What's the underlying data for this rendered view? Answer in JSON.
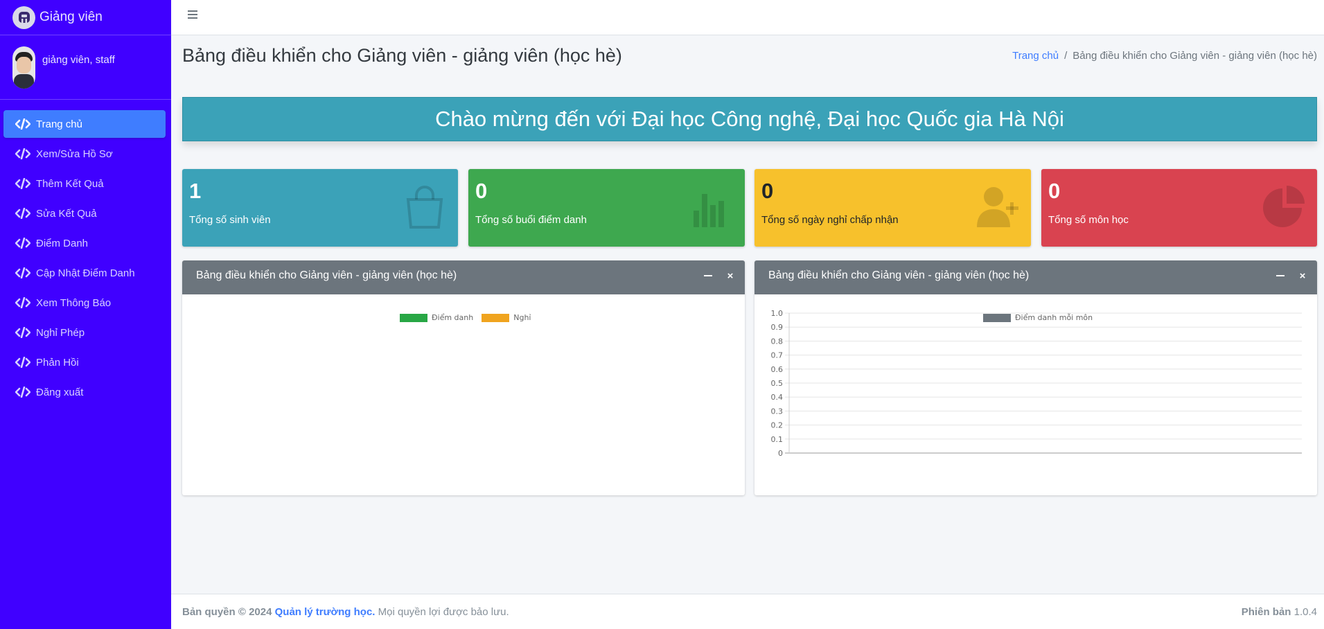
{
  "brand": {
    "title": "Giảng viên"
  },
  "user": {
    "name": "giảng viên, staff"
  },
  "sidebar": {
    "items": [
      {
        "label": "Trang chủ",
        "active": true
      },
      {
        "label": "Xem/Sửa Hồ Sơ"
      },
      {
        "label": "Thêm Kết Quả"
      },
      {
        "label": "Sửa Kết Quả"
      },
      {
        "label": "Điểm Danh"
      },
      {
        "label": "Cập Nhật Điểm Danh"
      },
      {
        "label": "Xem Thông Báo"
      },
      {
        "label": "Nghỉ Phép"
      },
      {
        "label": "Phản Hồi"
      },
      {
        "label": "Đăng xuất"
      }
    ]
  },
  "header": {
    "title": "Bảng điều khiển cho Giảng viên - giảng viên (học hè)",
    "breadcrumb": {
      "home": "Trang chủ",
      "separator": "/",
      "current": "Bảng điều khiển cho Giảng viên - giảng viên (học hè)"
    }
  },
  "banner": {
    "text": "Chào mừng đến với Đại học Công nghệ, Đại học Quốc gia Hà Nội"
  },
  "stats": [
    {
      "value": "1",
      "label": "Tổng số sinh viên",
      "icon": "shopping-bag-icon",
      "color": "#3ba2b8"
    },
    {
      "value": "0",
      "label": "Tổng số buổi điểm danh",
      "icon": "bar-chart-icon",
      "color": "#3ea84f"
    },
    {
      "value": "0",
      "label": "Tổng số ngày nghỉ chấp nhận",
      "icon": "user-plus-icon",
      "color": "#f7c12c"
    },
    {
      "value": "0",
      "label": "Tổng số môn học",
      "icon": "pie-chart-icon",
      "color": "#d94350"
    }
  ],
  "cards": {
    "left": {
      "title": "Bảng điều khiển cho Giảng viên - giảng viên (học hè)",
      "minimize": "–",
      "close": "×"
    },
    "right": {
      "title": "Bảng điều khiển cho Giảng viên - giảng viên (học hè)",
      "minimize": "–",
      "close": "×"
    }
  },
  "chart_data": [
    {
      "type": "bar",
      "title": "",
      "series": [
        {
          "name": "Điểm danh",
          "color": "#28a745",
          "values": []
        },
        {
          "name": "Nghỉ",
          "color": "#f0a41f",
          "values": []
        }
      ],
      "categories": []
    },
    {
      "type": "bar",
      "title": "",
      "series": [
        {
          "name": "Điểm danh mỗi môn",
          "color": "#6c757d",
          "values": []
        }
      ],
      "categories": [],
      "yticks": [
        "1.0",
        "0.9",
        "0.8",
        "0.7",
        "0.6",
        "0.5",
        "0.4",
        "0.3",
        "0.2",
        "0.1",
        "0"
      ],
      "ylim": [
        0,
        1.0
      ],
      "grid": true,
      "legend": "top"
    }
  ],
  "footer": {
    "copyright_prefix": "Bản quyền © 2024",
    "app_name": "Quản lý trường học.",
    "rights": "Mọi quyền lợi được bảo lưu.",
    "version_label": "Phiên bản",
    "version": "1.0.4"
  }
}
